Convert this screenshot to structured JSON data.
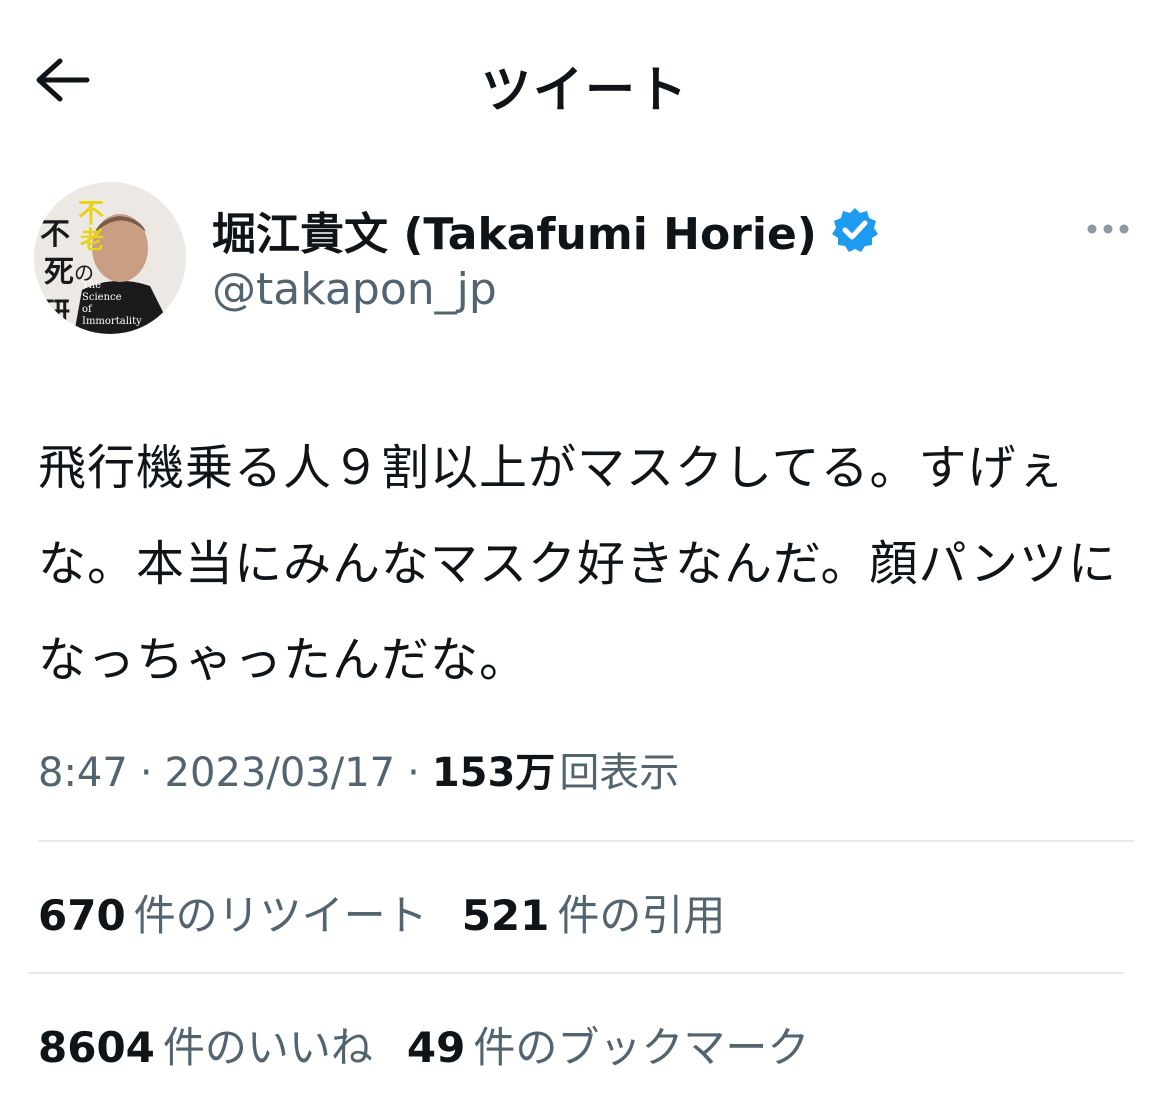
{
  "header": {
    "title": "ツイート",
    "back_icon": "arrow-left-icon"
  },
  "author": {
    "name": "堀江貴文 (Takafumi Horie)",
    "handle": "@takapon_jp",
    "verified_icon": "verified-badge-icon",
    "verified_color": "#1d9bf0",
    "avatar_text": {
      "title_top": "不老",
      "title_bottom": "不死の研究",
      "subtitle": "The Science of Immortality"
    }
  },
  "more_icon": "more-horizontal-icon",
  "tweet": {
    "text": "飛行機乗る人９割以上がマスクしてる。すげぇな。本当にみんなマスク好きなんだ。顔パンツになっちゃったんだな。"
  },
  "meta": {
    "time": "8:47",
    "separator": "·",
    "date": "2023/03/17",
    "views_count": "153万",
    "views_label": "回表示"
  },
  "stats": [
    {
      "count": "670",
      "label": "件のリツイート"
    },
    {
      "count": "521",
      "label": "件の引用"
    },
    {
      "count": "8604",
      "label": "件のいいね"
    },
    {
      "count": "49",
      "label": "件のブックマーク"
    }
  ],
  "colors": {
    "text_primary": "#0f1419",
    "text_secondary": "#536471",
    "divider": "#e6e9eb"
  }
}
